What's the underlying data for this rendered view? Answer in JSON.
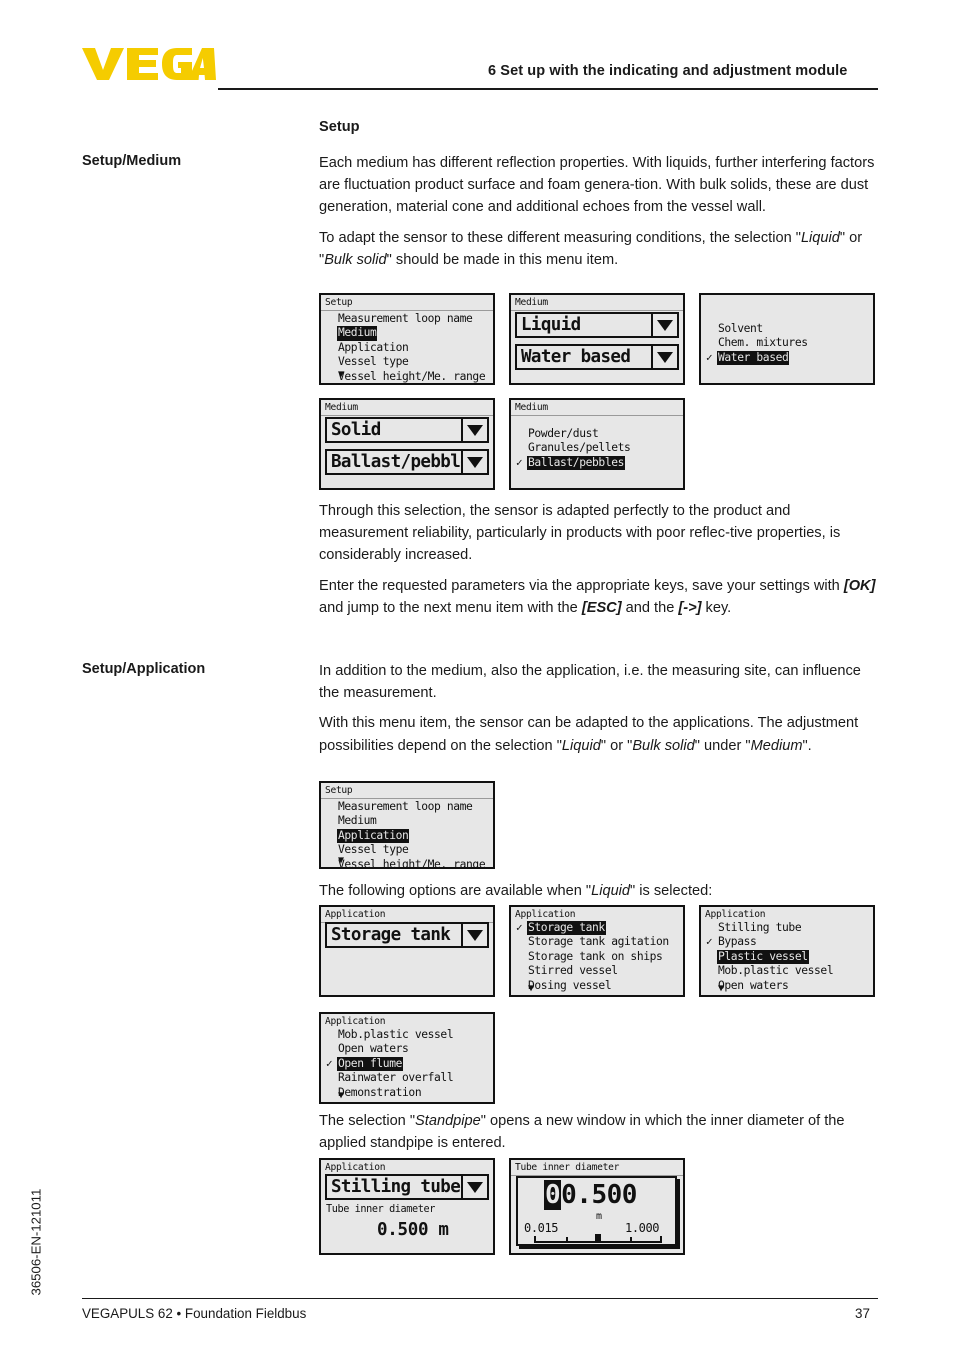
{
  "header": {
    "title": "6 Set up with the indicating and adjustment module",
    "logo_text": "VEGA",
    "logo_color": "#F5CC00"
  },
  "sections": {
    "setup_heading": "Setup",
    "label_medium": "Setup/Medium",
    "label_application": "Setup/Application",
    "medium_p1": "Each medium has different reflection properties. With liquids, further interfering factors are fluctuation product surface and foam genera-tion. With bulk solids, these are dust generation, material cone and additional echoes from the vessel wall.",
    "medium_p2_a": "To adapt the sensor to these different measuring conditions, the selection \"",
    "medium_p2_i1": "Liquid",
    "medium_p2_b": "\" or \"",
    "medium_p2_i2": "Bulk solid",
    "medium_p2_c": "\" should be made in this menu item.",
    "medium_p3": "Through this selection, the sensor is adapted perfectly to the product and measurement reliability, particularly in products with poor reflec-tive properties, is considerably increased.",
    "medium_p4_a": "Enter the requested parameters via the appropriate keys, save your settings with ",
    "medium_p4_k1": "[OK]",
    "medium_p4_b": " and jump to the next menu item with the ",
    "medium_p4_k2": "[ESC]",
    "medium_p4_c": " and the ",
    "medium_p4_k3": "[->]",
    "medium_p4_d": " key.",
    "app_p1": "In addition to the medium, also the application, i.e. the measuring site, can influence the measurement.",
    "app_p2_a": "With this menu item, the sensor can be adapted to the applications. The adjustment possibilities depend on the selection \"",
    "app_p2_i1": "Liquid",
    "app_p2_b": "\" or \"",
    "app_p2_i2": "Bulk solid",
    "app_p2_c": "\" under \"",
    "app_p2_i3": "Medium",
    "app_p2_d": "\".",
    "app_p3_a": "The following options are available when \"",
    "app_p3_i1": "Liquid",
    "app_p3_b": "\" is selected:",
    "app_p4_a": "The selection \"",
    "app_p4_i1": "Standpipe",
    "app_p4_b": "\" opens a new window in which the inner diameter of the applied standpipe is entered."
  },
  "lcd": {
    "setup_medium_menu": {
      "title": "Setup",
      "items": [
        "Measurement loop name",
        "Medium",
        "Application",
        "Vessel type",
        "Vessel height/Me. range"
      ],
      "selected": "Medium",
      "scroll_arrow": "down-arrow-icon"
    },
    "medium_liquid_combo": {
      "title": "Medium",
      "value1": "Liquid",
      "value2": "Water based",
      "arrow_icon": "chevron-down-icon"
    },
    "medium_liquid_list": {
      "title": "",
      "items": [
        "Solvent",
        "Chem. mixtures",
        "Water based"
      ],
      "selected": "Water based",
      "checked": "Water based",
      "check_icon": "check-icon"
    },
    "medium_solid_combo": {
      "title": "Medium",
      "value1": "Solid",
      "value2": "Ballast/pebbles",
      "arrow_icon": "chevron-down-icon"
    },
    "medium_solid_list": {
      "title": "Medium",
      "items": [
        "Powder/dust",
        "Granules/pellets",
        "Ballast/pebbles"
      ],
      "selected": "Ballast/pebbles",
      "checked": "Ballast/pebbles",
      "check_icon": "check-icon"
    },
    "setup_application_menu": {
      "title": "Setup",
      "items": [
        "Measurement loop name",
        "Medium",
        "Application",
        "Vessel type",
        "Vessel height/Me. range"
      ],
      "selected": "Application",
      "scroll_arrow": "down-arrow-icon"
    },
    "application_combo": {
      "title": "Application",
      "value1": "Storage tank",
      "arrow_icon": "chevron-down-icon"
    },
    "application_list_1": {
      "title": "Application",
      "items": [
        "Storage tank",
        "Storage tank agitation",
        "Storage tank on ships",
        "Stirred vessel",
        "Dosing vessel"
      ],
      "selected": "Storage tank",
      "checked": "Storage tank",
      "check_icon": "check-icon",
      "scroll_arrow": "down-arrow-icon"
    },
    "application_list_2": {
      "title": "Application",
      "items": [
        "Stilling tube",
        "Bypass",
        "Plastic vessel",
        "Mob.plastic vessel",
        "Open waters"
      ],
      "selected": "Plastic vessel",
      "checked": "Bypass",
      "check_icon": "check-icon",
      "scroll_arrow": "down-arrow-icon"
    },
    "application_list_3": {
      "title": "Application",
      "items": [
        "Mob.plastic vessel",
        "Open waters",
        "Open flume",
        "Rainwater overfall",
        "Demonstration"
      ],
      "selected": "Open flume",
      "checked": "Open flume",
      "check_icon": "check-icon",
      "scroll_arrow": "down-arrow-icon"
    },
    "stilling_tube": {
      "title": "Application",
      "value1": "Stilling tube",
      "arrow_icon": "chevron-down-icon",
      "sublabel": "Tube inner diameter",
      "value": "0.500 m"
    },
    "tube_inner_diameter": {
      "title": "Tube inner diameter",
      "cursor_digit": "0",
      "value_rest": "0.500",
      "unit": "m",
      "min": "0.015",
      "max": "1.000"
    }
  },
  "footer": {
    "left": "VEGAPULS 62 • Foundation Fieldbus",
    "page": "37",
    "side_code": "36506-EN-121011"
  }
}
